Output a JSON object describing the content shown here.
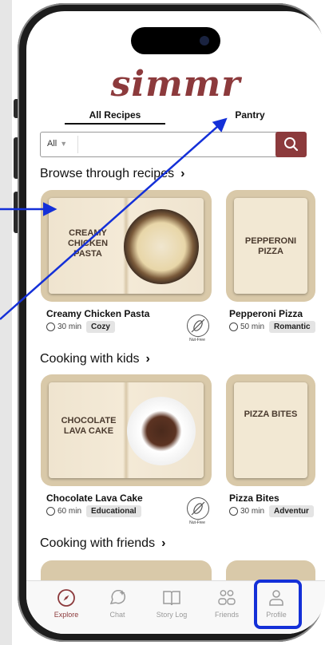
{
  "app": {
    "logo": "simmr"
  },
  "tabs": [
    {
      "label": "All Recipes",
      "active": true
    },
    {
      "label": "Pantry",
      "active": false
    }
  ],
  "search": {
    "filter_value": "All",
    "query": ""
  },
  "sections": [
    {
      "title": "Browse through recipes",
      "cards": [
        {
          "name": "Creamy Chicken Pasta",
          "book_text": "CREAMY CHICKEN PASTA",
          "time": "30 min",
          "tag": "Cozy",
          "badge": "Nut-Free"
        },
        {
          "name": "Pepperoni Pizza",
          "book_text": "PEPPERONI PIZZA",
          "time": "50 min",
          "tag": "Romantic"
        }
      ]
    },
    {
      "title": "Cooking with kids",
      "cards": [
        {
          "name": "Chocolate Lava Cake",
          "book_text": "CHOCOLATE LAVA CAKE",
          "time": "60 min",
          "tag": "Educational",
          "badge": "Nut-Free"
        },
        {
          "name": "Pizza Bites",
          "book_text": "PIZZA BITES",
          "time": "30 min",
          "tag": "Adventur"
        }
      ]
    },
    {
      "title": "Cooking with friends"
    }
  ],
  "nav": [
    {
      "label": "Explore",
      "icon": "compass-icon",
      "active": true
    },
    {
      "label": "Chat",
      "icon": "chat-sparkle-icon",
      "active": false
    },
    {
      "label": "Story Log",
      "icon": "book-icon",
      "active": false
    },
    {
      "label": "Friends",
      "icon": "friends-icon",
      "active": false
    },
    {
      "label": "Profile",
      "icon": "profile-icon",
      "active": false,
      "highlighted": true
    }
  ],
  "colors": {
    "brand": "#8c3a3c",
    "highlight": "#1430d8"
  }
}
